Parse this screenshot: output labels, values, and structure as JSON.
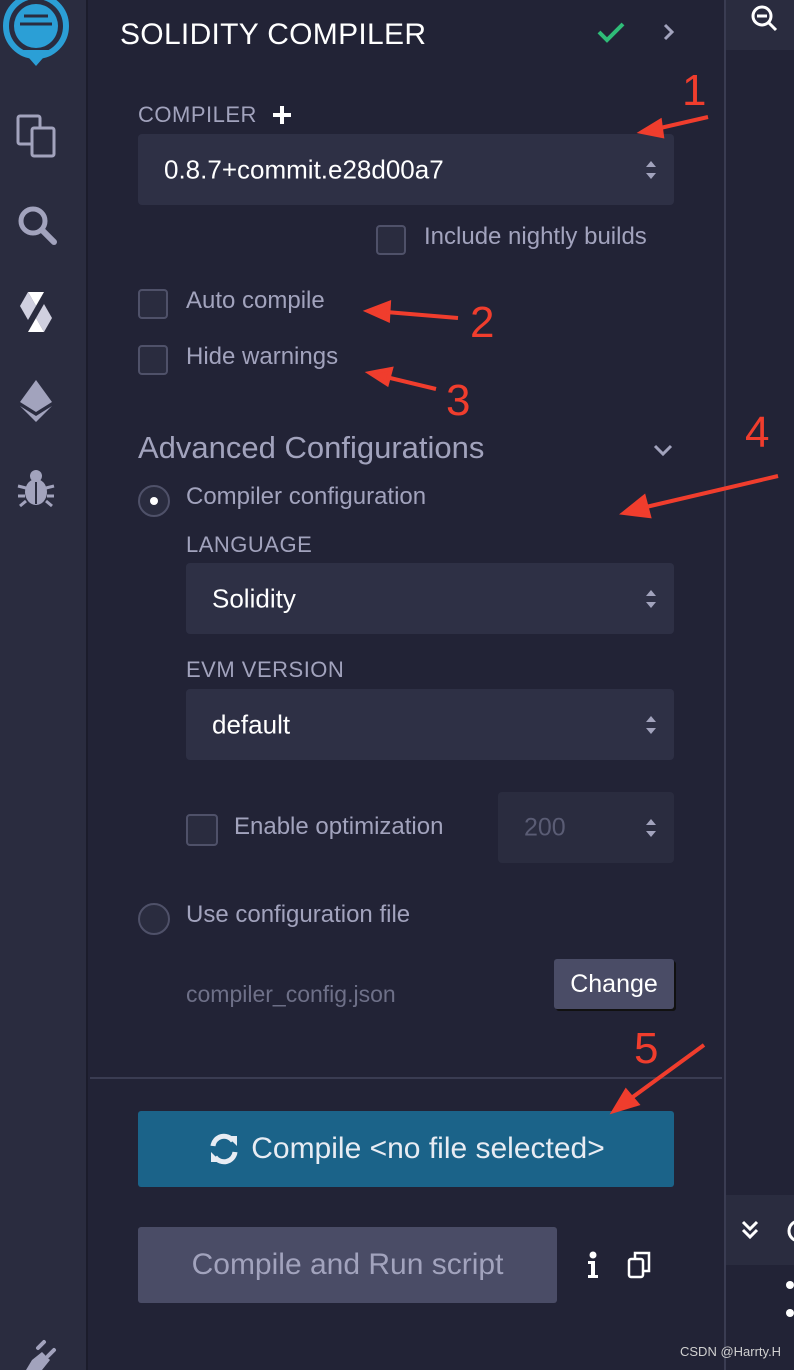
{
  "panel": {
    "title": "SOLIDITY COMPILER",
    "compiler_label": "COMPILER",
    "compiler_version": "0.8.7+commit.e28d00a7",
    "include_nightly_label": "Include nightly builds",
    "auto_compile_label": "Auto compile",
    "hide_warnings_label": "Hide warnings",
    "advanced_label": "Advanced Configurations",
    "compiler_config_label": "Compiler configuration",
    "language_label": "LANGUAGE",
    "language_value": "Solidity",
    "evm_label": "EVM VERSION",
    "evm_value": "default",
    "enable_optimization_label": "Enable optimization",
    "optimization_runs": "200",
    "use_config_file_label": "Use configuration file",
    "config_file_name": "compiler_config.json",
    "change_label": "Change",
    "compile_label": "Compile <no file selected>",
    "compile_run_label": "Compile and Run script"
  },
  "annotations": [
    "1",
    "2",
    "3",
    "4",
    "5"
  ],
  "watermark": "CSDN @Harrty.H",
  "icons": {
    "sidebar": [
      "remix-logo-icon",
      "file-explorer-icon",
      "search-icon",
      "solidity-compiler-icon",
      "deploy-run-icon",
      "debugger-icon",
      "plugin-manager-icon"
    ],
    "header": [
      "check-icon",
      "chevron-right-icon"
    ],
    "right": [
      "zoom-out-icon",
      "double-chevron-down-icon"
    ]
  },
  "colors": {
    "accent_blue": "#1b6389",
    "check_green": "#2fbc78",
    "annotation_red": "#f03d2d",
    "panel_bg": "#222336"
  }
}
